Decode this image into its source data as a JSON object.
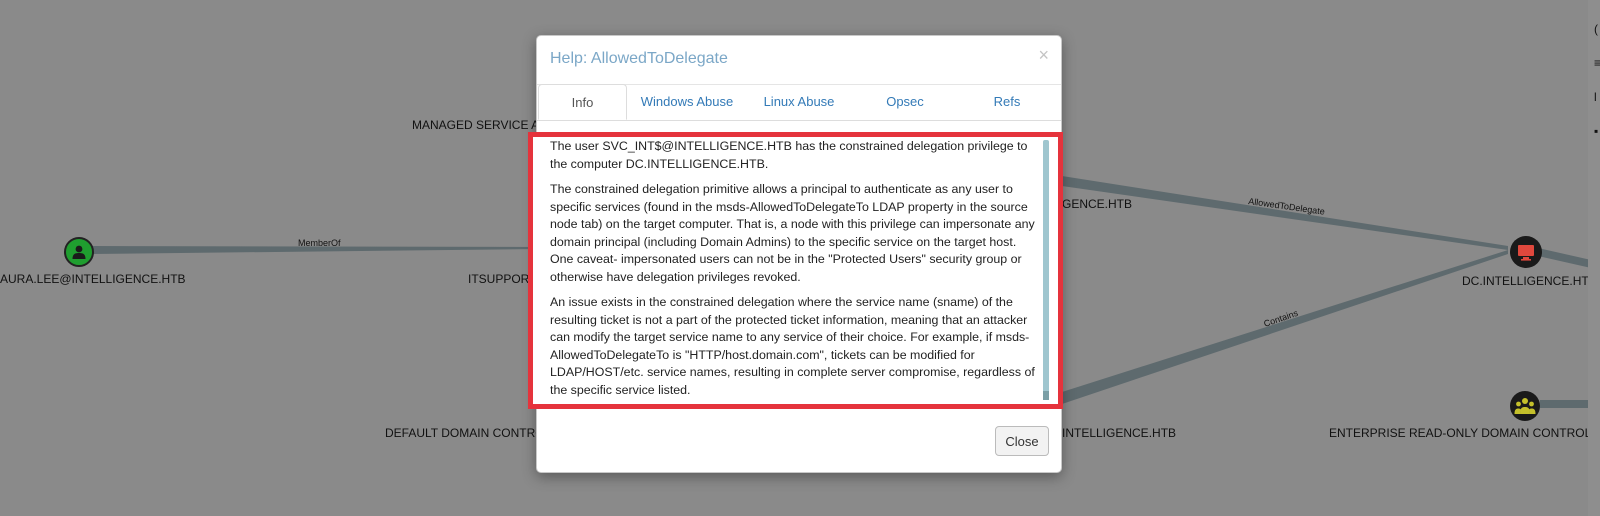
{
  "graph": {
    "labels": {
      "managed_service": "MANAGED SERVICE AC",
      "laura": "AURA.LEE@INTELLIGENCE.HTB",
      "itsupport": "ITSUPPOR",
      "default_domain": "DEFAULT DOMAIN CONTRO",
      "intel_top": "GENCE.HTB",
      "intel_bottom": "INTELLIGENCE.HTB",
      "dc": "DC.INTELLIGENCE.HTB",
      "enterprise": "ENTERPRISE READ-ONLY DOMAIN CONTROLLERS"
    },
    "edges": {
      "memberof": "MemberOf",
      "allowedtodelegate": "AllowedToDelegate",
      "contains": "Contains"
    },
    "colors": {
      "user_node": "#1f9e2f",
      "computer_node": "#e0483d",
      "group_node": "#c4c02b",
      "edge": "#5e6a6e"
    }
  },
  "modal": {
    "title": "Help: AllowedToDelegate",
    "close_symbol": "×",
    "tabs": [
      {
        "label": "Info",
        "active": true
      },
      {
        "label": "Windows Abuse",
        "active": false
      },
      {
        "label": "Linux Abuse",
        "active": false
      },
      {
        "label": "Opsec",
        "active": false
      },
      {
        "label": "Refs",
        "active": false
      }
    ],
    "paragraphs": [
      "The user SVC_INT$@INTELLIGENCE.HTB has the constrained delegation privilege to the computer DC.INTELLIGENCE.HTB.",
      "The constrained delegation primitive allows a principal to authenticate as any user to specific services (found in the msds-AllowedToDelegateTo LDAP property in the source node tab) on the target computer. That is, a node with this privilege can impersonate any domain principal (including Domain Admins) to the specific service on the target host. One caveat- impersonated users can not be in the \"Protected Users\" security group or otherwise have delegation privileges revoked.",
      "An issue exists in the constrained delegation where the service name (sname) of the resulting ticket is not a part of the protected ticket information, meaning that an attacker can modify the target service name to any service of their choice. For example, if msds-AllowedToDelegateTo is \"HTTP/host.domain.com\", tickets can be modified for LDAP/HOST/etc. service names, resulting in complete server compromise, regardless of the specific service listed."
    ],
    "footer": {
      "close_label": "Close"
    },
    "highlight_color": "#e5333c"
  }
}
